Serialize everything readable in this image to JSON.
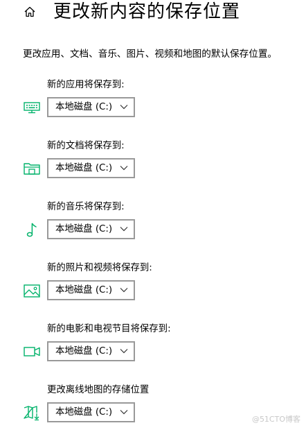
{
  "header": {
    "title": "更改新内容的保存位置"
  },
  "description": "更改应用、文档、音乐、图片、视频和地图的默认保存位置。",
  "colors": {
    "accent": "#00b26a",
    "dropdown_border": "#999999"
  },
  "settings": [
    {
      "label": "新的应用将保存到:",
      "icon": "keyboard-icon",
      "value": "本地磁盘 (C:)"
    },
    {
      "label": "新的文档将保存到:",
      "icon": "folder-icon",
      "value": "本地磁盘 (C:)"
    },
    {
      "label": "新的音乐将保存到:",
      "icon": "music-note-icon",
      "value": "本地磁盘 (C:)"
    },
    {
      "label": "新的照片和视频将保存到:",
      "icon": "picture-icon",
      "value": "本地磁盘 (C:)"
    },
    {
      "label": "新的电影和电视节目将保存到:",
      "icon": "video-camera-icon",
      "value": "本地磁盘 (C:)"
    },
    {
      "label": "更改离线地图的存储位置",
      "icon": "map-download-icon",
      "value": "本地磁盘 (C:)"
    }
  ],
  "watermark": "@51CTO博客"
}
